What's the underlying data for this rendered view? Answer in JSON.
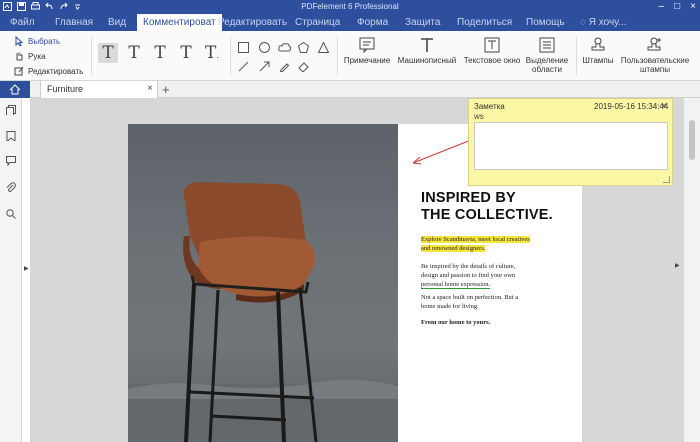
{
  "app": {
    "title": "PDFelement 6 Professional"
  },
  "menu": {
    "items": [
      "Файл",
      "Главная",
      "Вид",
      "Комментироват",
      "Редактировать",
      "Страница",
      "Форма",
      "Защита",
      "Поделиться",
      "Помощь"
    ],
    "active_index": 3,
    "search_label": "Я хочу..."
  },
  "ribbon": {
    "select_label": "Выбрать",
    "hand_label": "Рука",
    "edit_label": "Редактировать",
    "note_label": "Примечание",
    "typewriter_label": "Машинописный",
    "textbox_label": "Текстовое окно",
    "area_label_1": "Выделение",
    "area_label_2": "области",
    "stamps_label": "Штампы",
    "custom_stamps_1": "Пользовательские",
    "custom_stamps_2": "штампы"
  },
  "tabs": {
    "doc_tab": "Furniture",
    "add_tab": "+"
  },
  "note": {
    "title": "Заметка",
    "date": "2019-05-16 15:34:44",
    "author": "ws",
    "close": "×",
    "text": ""
  },
  "document": {
    "heading_1": "INSPIRED BY",
    "heading_2": "THE COLLECTIVE.",
    "hl_line_1": "Explore Scandinavia, meet local creatives",
    "hl_line_2": "and renowned designers.",
    "p2_line_1": "Be inspired by the details of culture,",
    "p2_line_2": "design and passion to find your own",
    "p2_line_3": "personal home expression.",
    "p3_line_1": "Not a space built on perfection. But a",
    "p3_line_2": "home made for living.",
    "p4_line_1": "From our home to yours."
  },
  "colors": {
    "accent": "#2d4f9e",
    "highlight": "#f7e63a",
    "underline": "#2b9a3a",
    "note_bg": "#fbf7a5",
    "arrow": "#d03838"
  }
}
